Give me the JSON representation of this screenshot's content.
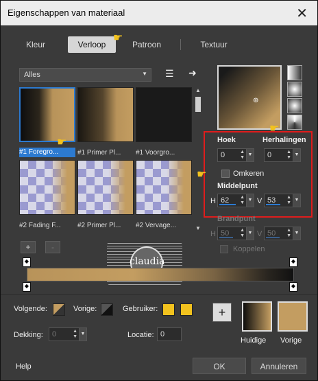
{
  "title": "Eigenschappen van materiaal",
  "close": "✕",
  "tabs": [
    "Kleur",
    "Verloop",
    "Patroon",
    "Textuur"
  ],
  "filter": {
    "value": "Alles"
  },
  "thumbs": [
    {
      "caption": "#1 Foregro..."
    },
    {
      "caption": "#1 Primer Pl..."
    },
    {
      "caption": "#1 Voorgro..."
    },
    {
      "caption": "#2 Fading F..."
    },
    {
      "caption": "#2 Primer Pl..."
    },
    {
      "caption": "#2 Vervage..."
    }
  ],
  "controls": {
    "hoek_label": "Hoek",
    "hoek_value": "0",
    "herhalingen_label": "Herhalingen",
    "herhalingen_value": "0",
    "omkeren_label": "Omkeren",
    "middelpunt_label": "Middelpunt",
    "h_label": "H",
    "h_value": "62",
    "v_label": "V",
    "v_value": "53",
    "brandpunt_label": "Brandpunt",
    "bh_label": "H",
    "bh_value": "50",
    "bv_label": "V",
    "bv_value": "50",
    "koppelen_label": "Koppelen"
  },
  "stops": {
    "add": "+",
    "remove": "-"
  },
  "bottom": {
    "volgende_label": "Volgende:",
    "vorige_label": "Vorige:",
    "gebruiker_label": "Gebruiker:",
    "dekking_label": "Dekking:",
    "dekking_value": "0",
    "locatie_label": "Locatie:",
    "locatie_value": "0",
    "plus": "+",
    "huidige_label": "Huidige",
    "vorige2_label": "Vorige"
  },
  "footer": {
    "help": "Help",
    "ok": "OK",
    "cancel": "Annuleren"
  },
  "watermark": {
    "text": "claudia"
  },
  "colors": {
    "gold": "#c39d61",
    "yellow": "#f2c21e",
    "accent": "#2c7ad0",
    "red": "#e01c1c"
  }
}
